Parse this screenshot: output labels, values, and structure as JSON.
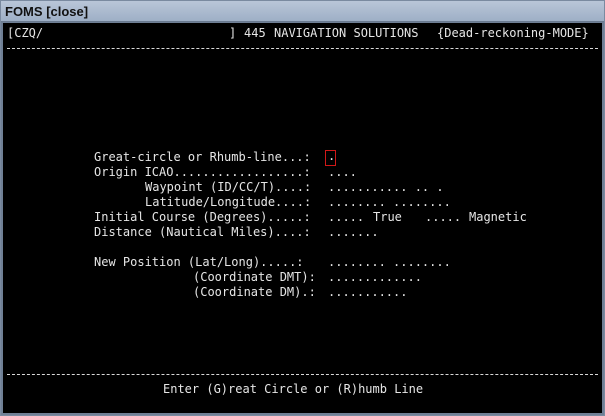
{
  "window": {
    "app_name": "FOMS",
    "close_label": "[close]"
  },
  "header": {
    "input_left": "[CZQ/",
    "input_right": "]",
    "solutions_count": "445",
    "solutions_label": "NAVIGATION SOLUTIONS",
    "mode": "{Dead-reckoning-MODE}"
  },
  "form": {
    "method_label": "Great-circle or Rhumb-line...:",
    "method_value": ".",
    "origin_label": "Origin ICAO..................:",
    "origin_value": "....",
    "waypoint_label": "Waypoint (ID/CC/T)....:",
    "waypoint_value": "........... .. .",
    "latlong_label": "Latitude/Longitude....:",
    "latlong_value": "........ ........",
    "course_label": "Initial Course (Degrees).....:",
    "course_true_value": ".....",
    "course_true_label": "True",
    "course_mag_value": ".....",
    "course_mag_label": "Magnetic",
    "distance_label": "Distance (Nautical Miles)....:",
    "distance_value": ".......",
    "newpos_label": "New Position (Lat/Long).....:",
    "newpos_value": "........ ........",
    "dmt_label": "(Coordinate DMT):",
    "dmt_value": ".............",
    "dm_label": "(Coordinate DM).:",
    "dm_value": "..........."
  },
  "footer": {
    "prompt": "Enter (G)reat Circle or (R)humb Line"
  },
  "colors": {
    "terminal_bg": "#000000",
    "terminal_fg": "#e6e6e6",
    "cursor_border": "#d01818",
    "titlebar": "#a9b8cc"
  }
}
